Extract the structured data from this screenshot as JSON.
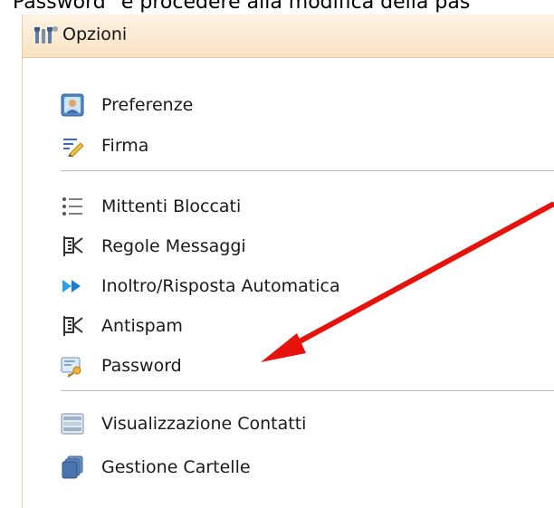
{
  "top_text": "Password\" e procedere alla modifica della pas",
  "panel": {
    "title": "Opzioni",
    "title_icon": "tools-icon"
  },
  "groups": [
    {
      "items": [
        {
          "label": "Preferenze",
          "icon": "user-profile-icon"
        },
        {
          "label": "Firma",
          "icon": "signature-pen-icon"
        }
      ]
    },
    {
      "items": [
        {
          "label": "Mittenti Bloccati",
          "icon": "blocked-list-icon"
        },
        {
          "label": "Regole Messaggi",
          "icon": "rules-icon"
        },
        {
          "label": "Inoltro/Risposta Automatica",
          "icon": "forward-icon"
        },
        {
          "label": "Antispam",
          "icon": "antispam-icon"
        },
        {
          "label": "Password",
          "icon": "password-key-icon"
        }
      ]
    },
    {
      "items": [
        {
          "label": "Visualizzazione Contatti",
          "icon": "contacts-view-icon"
        },
        {
          "label": "Gestione Cartelle",
          "icon": "folders-icon"
        }
      ]
    }
  ],
  "annotation": {
    "arrow_color": "#e8120c",
    "points_to": "Password"
  },
  "colors": {
    "header_bg": "#f8e2c2",
    "header_border": "#e7c79f",
    "divider": "#bbbbbb",
    "text": "#1a1a1a"
  }
}
